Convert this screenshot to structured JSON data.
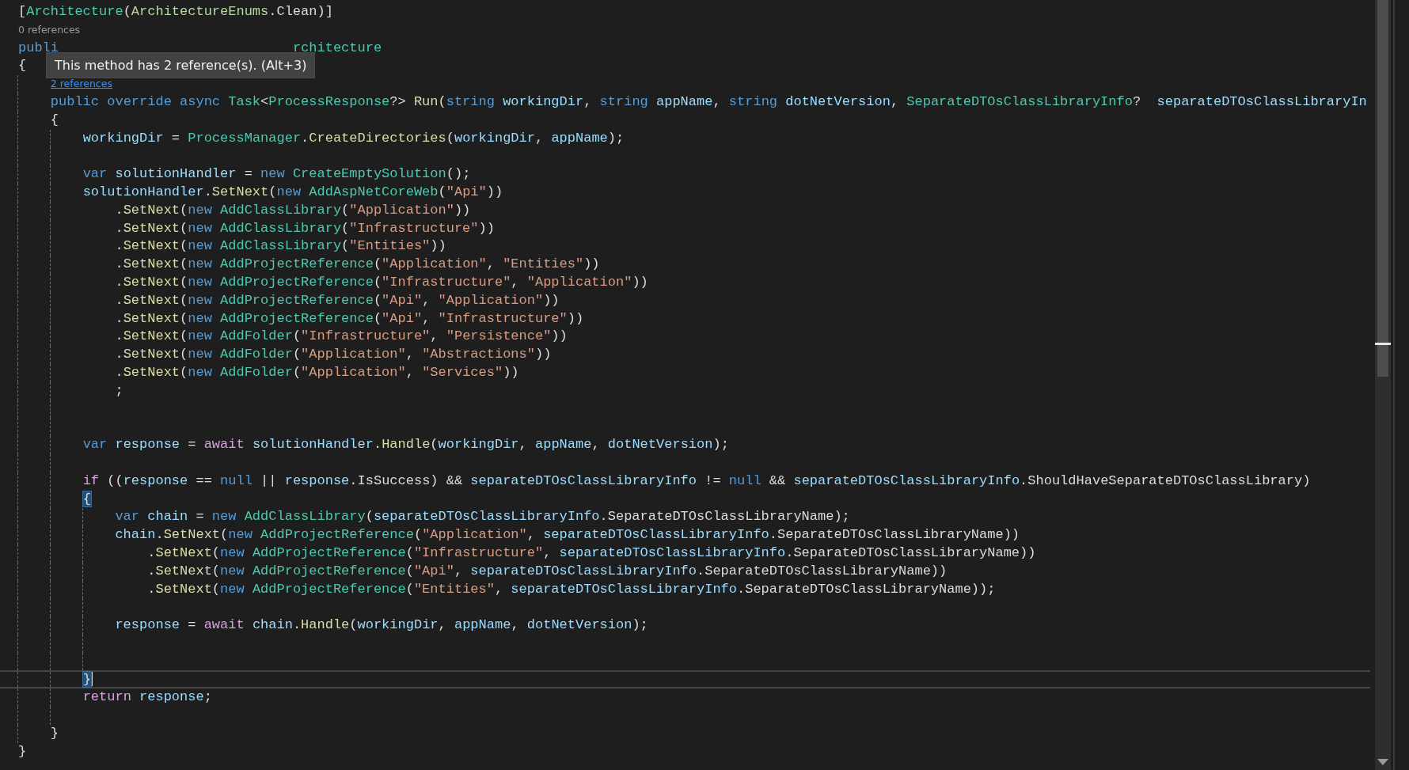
{
  "tooltip": {
    "text": "This method has 2 reference(s). (Alt+3)"
  },
  "lines": [
    {
      "current": false,
      "tokens": [
        {
          "kind": "plain",
          "text": "["
        },
        {
          "kind": "type",
          "text": "Architecture"
        },
        {
          "kind": "plain",
          "text": "("
        },
        {
          "kind": "enum",
          "text": "ArchitectureEnums"
        },
        {
          "kind": "plain",
          "text": ".Clean)]"
        }
      ]
    },
    {
      "current": false,
      "tokens": [
        {
          "kind": "lens",
          "text": "0 references"
        }
      ]
    },
    {
      "current": false,
      "tokens": [
        {
          "kind": "keyword",
          "text": "publi"
        },
        {
          "kind": "type",
          "text": "                             rchitecture"
        }
      ]
    },
    {
      "current": false,
      "tokens": [
        {
          "kind": "plain",
          "text": "{"
        }
      ]
    },
    {
      "current": false,
      "tokens": [
        {
          "kind": "lens-link",
          "text": "    2 references"
        }
      ]
    },
    {
      "current": false,
      "tokens": [
        {
          "kind": "keyword",
          "text": "    public override async "
        },
        {
          "kind": "type",
          "text": "Task"
        },
        {
          "kind": "plain",
          "text": "<"
        },
        {
          "kind": "type",
          "text": "ProcessResponse"
        },
        {
          "kind": "plain",
          "text": "?> "
        },
        {
          "kind": "method",
          "text": "Run"
        },
        {
          "kind": "plain",
          "text": "("
        },
        {
          "kind": "keyword",
          "text": "string "
        },
        {
          "kind": "variable",
          "text": "workingDir"
        },
        {
          "kind": "plain",
          "text": ", "
        },
        {
          "kind": "keyword",
          "text": "string "
        },
        {
          "kind": "variable",
          "text": "appName"
        },
        {
          "kind": "plain",
          "text": ", "
        },
        {
          "kind": "keyword",
          "text": "string "
        },
        {
          "kind": "variable",
          "text": "dotNetVersion"
        },
        {
          "kind": "plain",
          "text": ", "
        },
        {
          "kind": "type",
          "text": "SeparateDTOsClassLibraryInfo"
        },
        {
          "kind": "plain",
          "text": "?  "
        },
        {
          "kind": "variable",
          "text": "separateDTOsClassLibraryIn"
        }
      ]
    },
    {
      "current": false,
      "tokens": [
        {
          "kind": "plain",
          "text": "    {"
        }
      ]
    },
    {
      "current": false,
      "tokens": [
        {
          "kind": "variable",
          "text": "        workingDir"
        },
        {
          "kind": "plain",
          "text": " = "
        },
        {
          "kind": "type",
          "text": "ProcessManager"
        },
        {
          "kind": "plain",
          "text": "."
        },
        {
          "kind": "method",
          "text": "CreateDirectories"
        },
        {
          "kind": "plain",
          "text": "("
        },
        {
          "kind": "variable",
          "text": "workingDir"
        },
        {
          "kind": "plain",
          "text": ", "
        },
        {
          "kind": "variable",
          "text": "appName"
        },
        {
          "kind": "plain",
          "text": ");"
        }
      ]
    },
    {
      "current": false
    },
    {
      "current": false,
      "tokens": [
        {
          "kind": "keyword",
          "text": "        var "
        },
        {
          "kind": "variable",
          "text": "solutionHandler"
        },
        {
          "kind": "plain",
          "text": " = "
        },
        {
          "kind": "keyword",
          "text": "new "
        },
        {
          "kind": "type",
          "text": "CreateEmptySolution"
        },
        {
          "kind": "plain",
          "text": "();"
        }
      ]
    },
    {
      "current": false,
      "tokens": [
        {
          "kind": "variable",
          "text": "        solutionHandler"
        },
        {
          "kind": "plain",
          "text": "."
        },
        {
          "kind": "method",
          "text": "SetNext"
        },
        {
          "kind": "plain",
          "text": "("
        },
        {
          "kind": "keyword",
          "text": "new "
        },
        {
          "kind": "type",
          "text": "AddAspNetCoreWeb"
        },
        {
          "kind": "plain",
          "text": "("
        },
        {
          "kind": "string",
          "text": "\"Api\""
        },
        {
          "kind": "plain",
          "text": "))"
        }
      ]
    },
    {
      "current": false,
      "tokens": [
        {
          "kind": "plain",
          "text": "            ."
        },
        {
          "kind": "method",
          "text": "SetNext"
        },
        {
          "kind": "plain",
          "text": "("
        },
        {
          "kind": "keyword",
          "text": "new "
        },
        {
          "kind": "type",
          "text": "AddClassLibrary"
        },
        {
          "kind": "plain",
          "text": "("
        },
        {
          "kind": "string",
          "text": "\"Application\""
        },
        {
          "kind": "plain",
          "text": "))"
        }
      ]
    },
    {
      "current": false,
      "tokens": [
        {
          "kind": "plain",
          "text": "            ."
        },
        {
          "kind": "method",
          "text": "SetNext"
        },
        {
          "kind": "plain",
          "text": "("
        },
        {
          "kind": "keyword",
          "text": "new "
        },
        {
          "kind": "type",
          "text": "AddClassLibrary"
        },
        {
          "kind": "plain",
          "text": "("
        },
        {
          "kind": "string",
          "text": "\"Infrastructure\""
        },
        {
          "kind": "plain",
          "text": "))"
        }
      ]
    },
    {
      "current": false,
      "tokens": [
        {
          "kind": "plain",
          "text": "            ."
        },
        {
          "kind": "method",
          "text": "SetNext"
        },
        {
          "kind": "plain",
          "text": "("
        },
        {
          "kind": "keyword",
          "text": "new "
        },
        {
          "kind": "type",
          "text": "AddClassLibrary"
        },
        {
          "kind": "plain",
          "text": "("
        },
        {
          "kind": "string",
          "text": "\"Entities\""
        },
        {
          "kind": "plain",
          "text": "))"
        }
      ]
    },
    {
      "current": false,
      "tokens": [
        {
          "kind": "plain",
          "text": "            ."
        },
        {
          "kind": "method",
          "text": "SetNext"
        },
        {
          "kind": "plain",
          "text": "("
        },
        {
          "kind": "keyword",
          "text": "new "
        },
        {
          "kind": "type",
          "text": "AddProjectReference"
        },
        {
          "kind": "plain",
          "text": "("
        },
        {
          "kind": "string",
          "text": "\"Application\""
        },
        {
          "kind": "plain",
          "text": ", "
        },
        {
          "kind": "string",
          "text": "\"Entities\""
        },
        {
          "kind": "plain",
          "text": "))"
        }
      ]
    },
    {
      "current": false,
      "tokens": [
        {
          "kind": "plain",
          "text": "            ."
        },
        {
          "kind": "method",
          "text": "SetNext"
        },
        {
          "kind": "plain",
          "text": "("
        },
        {
          "kind": "keyword",
          "text": "new "
        },
        {
          "kind": "type",
          "text": "AddProjectReference"
        },
        {
          "kind": "plain",
          "text": "("
        },
        {
          "kind": "string",
          "text": "\"Infrastructure\""
        },
        {
          "kind": "plain",
          "text": ", "
        },
        {
          "kind": "string",
          "text": "\"Application\""
        },
        {
          "kind": "plain",
          "text": "))"
        }
      ]
    },
    {
      "current": false,
      "tokens": [
        {
          "kind": "plain",
          "text": "            ."
        },
        {
          "kind": "method",
          "text": "SetNext"
        },
        {
          "kind": "plain",
          "text": "("
        },
        {
          "kind": "keyword",
          "text": "new "
        },
        {
          "kind": "type",
          "text": "AddProjectReference"
        },
        {
          "kind": "plain",
          "text": "("
        },
        {
          "kind": "string",
          "text": "\"Api\""
        },
        {
          "kind": "plain",
          "text": ", "
        },
        {
          "kind": "string",
          "text": "\"Application\""
        },
        {
          "kind": "plain",
          "text": "))"
        }
      ]
    },
    {
      "current": false,
      "tokens": [
        {
          "kind": "plain",
          "text": "            ."
        },
        {
          "kind": "method",
          "text": "SetNext"
        },
        {
          "kind": "plain",
          "text": "("
        },
        {
          "kind": "keyword",
          "text": "new "
        },
        {
          "kind": "type",
          "text": "AddProjectReference"
        },
        {
          "kind": "plain",
          "text": "("
        },
        {
          "kind": "string",
          "text": "\"Api\""
        },
        {
          "kind": "plain",
          "text": ", "
        },
        {
          "kind": "string",
          "text": "\"Infrastructure\""
        },
        {
          "kind": "plain",
          "text": "))"
        }
      ]
    },
    {
      "current": false,
      "tokens": [
        {
          "kind": "plain",
          "text": "            ."
        },
        {
          "kind": "method",
          "text": "SetNext"
        },
        {
          "kind": "plain",
          "text": "("
        },
        {
          "kind": "keyword",
          "text": "new "
        },
        {
          "kind": "type",
          "text": "AddFolder"
        },
        {
          "kind": "plain",
          "text": "("
        },
        {
          "kind": "string",
          "text": "\"Infrastructure\""
        },
        {
          "kind": "plain",
          "text": ", "
        },
        {
          "kind": "string",
          "text": "\"Persistence\""
        },
        {
          "kind": "plain",
          "text": "))"
        }
      ]
    },
    {
      "current": false,
      "tokens": [
        {
          "kind": "plain",
          "text": "            ."
        },
        {
          "kind": "method",
          "text": "SetNext"
        },
        {
          "kind": "plain",
          "text": "("
        },
        {
          "kind": "keyword",
          "text": "new "
        },
        {
          "kind": "type",
          "text": "AddFolder"
        },
        {
          "kind": "plain",
          "text": "("
        },
        {
          "kind": "string",
          "text": "\"Application\""
        },
        {
          "kind": "plain",
          "text": ", "
        },
        {
          "kind": "string",
          "text": "\"Abstractions\""
        },
        {
          "kind": "plain",
          "text": "))"
        }
      ]
    },
    {
      "current": false,
      "tokens": [
        {
          "kind": "plain",
          "text": "            ."
        },
        {
          "kind": "method",
          "text": "SetNext"
        },
        {
          "kind": "plain",
          "text": "("
        },
        {
          "kind": "keyword",
          "text": "new "
        },
        {
          "kind": "type",
          "text": "AddFolder"
        },
        {
          "kind": "plain",
          "text": "("
        },
        {
          "kind": "string",
          "text": "\"Application\""
        },
        {
          "kind": "plain",
          "text": ", "
        },
        {
          "kind": "string",
          "text": "\"Services\""
        },
        {
          "kind": "plain",
          "text": "))"
        }
      ]
    },
    {
      "current": false,
      "tokens": [
        {
          "kind": "plain",
          "text": "            ;"
        }
      ]
    },
    {
      "current": false
    },
    {
      "current": false
    },
    {
      "current": false,
      "tokens": [
        {
          "kind": "keyword",
          "text": "        var "
        },
        {
          "kind": "variable",
          "text": "response"
        },
        {
          "kind": "plain",
          "text": " = "
        },
        {
          "kind": "control",
          "text": "await "
        },
        {
          "kind": "variable",
          "text": "solutionHandler"
        },
        {
          "kind": "plain",
          "text": "."
        },
        {
          "kind": "method",
          "text": "Handle"
        },
        {
          "kind": "plain",
          "text": "("
        },
        {
          "kind": "variable",
          "text": "workingDir"
        },
        {
          "kind": "plain",
          "text": ", "
        },
        {
          "kind": "variable",
          "text": "appName"
        },
        {
          "kind": "plain",
          "text": ", "
        },
        {
          "kind": "variable",
          "text": "dotNetVersion"
        },
        {
          "kind": "plain",
          "text": ");"
        }
      ]
    },
    {
      "current": false
    },
    {
      "current": false,
      "tokens": [
        {
          "kind": "control",
          "text": "        if"
        },
        {
          "kind": "plain",
          "text": " (("
        },
        {
          "kind": "variable",
          "text": "response"
        },
        {
          "kind": "plain",
          "text": " == "
        },
        {
          "kind": "keyword",
          "text": "null"
        },
        {
          "kind": "plain",
          "text": " || "
        },
        {
          "kind": "variable",
          "text": "response"
        },
        {
          "kind": "plain",
          "text": ".IsSuccess) && "
        },
        {
          "kind": "variable",
          "text": "separateDTOsClassLibraryInfo"
        },
        {
          "kind": "plain",
          "text": " != "
        },
        {
          "kind": "keyword",
          "text": "null"
        },
        {
          "kind": "plain",
          "text": " && "
        },
        {
          "kind": "variable",
          "text": "separateDTOsClassLibraryInfo"
        },
        {
          "kind": "plain",
          "text": ".ShouldHaveSeparateDTOsClassLibrary)"
        }
      ]
    },
    {
      "current": false,
      "tokens": [
        {
          "kind": "brace-match",
          "text": "        {"
        }
      ]
    },
    {
      "current": false,
      "tokens": [
        {
          "kind": "keyword",
          "text": "            var "
        },
        {
          "kind": "variable",
          "text": "chain"
        },
        {
          "kind": "plain",
          "text": " = "
        },
        {
          "kind": "keyword",
          "text": "new "
        },
        {
          "kind": "type",
          "text": "AddClassLibrary"
        },
        {
          "kind": "plain",
          "text": "("
        },
        {
          "kind": "variable",
          "text": "separateDTOsClassLibraryInfo"
        },
        {
          "kind": "plain",
          "text": ".SeparateDTOsClassLibraryName);"
        }
      ]
    },
    {
      "current": false,
      "tokens": [
        {
          "kind": "variable",
          "text": "            chain"
        },
        {
          "kind": "plain",
          "text": "."
        },
        {
          "kind": "method",
          "text": "SetNext"
        },
        {
          "kind": "plain",
          "text": "("
        },
        {
          "kind": "keyword",
          "text": "new "
        },
        {
          "kind": "type",
          "text": "AddProjectReference"
        },
        {
          "kind": "plain",
          "text": "("
        },
        {
          "kind": "string",
          "text": "\"Application\""
        },
        {
          "kind": "plain",
          "text": ", "
        },
        {
          "kind": "variable",
          "text": "separateDTOsClassLibraryInfo"
        },
        {
          "kind": "plain",
          "text": ".SeparateDTOsClassLibraryName))"
        }
      ]
    },
    {
      "current": false,
      "tokens": [
        {
          "kind": "plain",
          "text": "                ."
        },
        {
          "kind": "method",
          "text": "SetNext"
        },
        {
          "kind": "plain",
          "text": "("
        },
        {
          "kind": "keyword",
          "text": "new "
        },
        {
          "kind": "type",
          "text": "AddProjectReference"
        },
        {
          "kind": "plain",
          "text": "("
        },
        {
          "kind": "string",
          "text": "\"Infrastructure\""
        },
        {
          "kind": "plain",
          "text": ", "
        },
        {
          "kind": "variable",
          "text": "separateDTOsClassLibraryInfo"
        },
        {
          "kind": "plain",
          "text": ".SeparateDTOsClassLibraryName))"
        }
      ]
    },
    {
      "current": false,
      "tokens": [
        {
          "kind": "plain",
          "text": "                ."
        },
        {
          "kind": "method",
          "text": "SetNext"
        },
        {
          "kind": "plain",
          "text": "("
        },
        {
          "kind": "keyword",
          "text": "new "
        },
        {
          "kind": "type",
          "text": "AddProjectReference"
        },
        {
          "kind": "plain",
          "text": "("
        },
        {
          "kind": "string",
          "text": "\"Api\""
        },
        {
          "kind": "plain",
          "text": ", "
        },
        {
          "kind": "variable",
          "text": "separateDTOsClassLibraryInfo"
        },
        {
          "kind": "plain",
          "text": ".SeparateDTOsClassLibraryName))"
        }
      ]
    },
    {
      "current": false,
      "tokens": [
        {
          "kind": "plain",
          "text": "                ."
        },
        {
          "kind": "method",
          "text": "SetNext"
        },
        {
          "kind": "plain",
          "text": "("
        },
        {
          "kind": "keyword",
          "text": "new "
        },
        {
          "kind": "type",
          "text": "AddProjectReference"
        },
        {
          "kind": "plain",
          "text": "("
        },
        {
          "kind": "string",
          "text": "\"Entities\""
        },
        {
          "kind": "plain",
          "text": ", "
        },
        {
          "kind": "variable",
          "text": "separateDTOsClassLibraryInfo"
        },
        {
          "kind": "plain",
          "text": ".SeparateDTOsClassLibraryName));"
        }
      ]
    },
    {
      "current": false
    },
    {
      "current": false,
      "tokens": [
        {
          "kind": "variable",
          "text": "            response"
        },
        {
          "kind": "plain",
          "text": " = "
        },
        {
          "kind": "control",
          "text": "await "
        },
        {
          "kind": "variable",
          "text": "chain"
        },
        {
          "kind": "plain",
          "text": "."
        },
        {
          "kind": "method",
          "text": "Handle"
        },
        {
          "kind": "plain",
          "text": "("
        },
        {
          "kind": "variable",
          "text": "workingDir"
        },
        {
          "kind": "plain",
          "text": ", "
        },
        {
          "kind": "variable",
          "text": "appName"
        },
        {
          "kind": "plain",
          "text": ", "
        },
        {
          "kind": "variable",
          "text": "dotNetVersion"
        },
        {
          "kind": "plain",
          "text": ");"
        }
      ]
    },
    {
      "current": false
    },
    {
      "current": false
    },
    {
      "current": true,
      "tokens": [
        {
          "kind": "brace-match",
          "text": "        }"
        }
      ]
    },
    {
      "current": false,
      "tokens": [
        {
          "kind": "control",
          "text": "        return "
        },
        {
          "kind": "variable",
          "text": "response"
        },
        {
          "kind": "plain",
          "text": ";"
        }
      ]
    },
    {
      "current": false
    },
    {
      "current": false,
      "tokens": [
        {
          "kind": "plain",
          "text": "    }"
        }
      ]
    },
    {
      "current": false,
      "tokens": [
        {
          "kind": "plain",
          "text": "}"
        }
      ]
    }
  ]
}
